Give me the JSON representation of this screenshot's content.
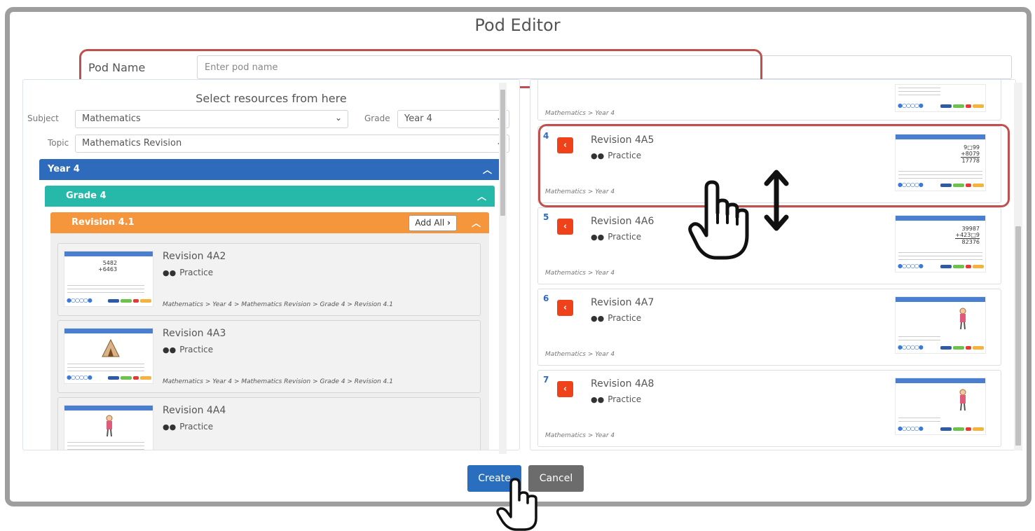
{
  "title": "Pod Editor",
  "pod_name": {
    "label": "Pod Name",
    "placeholder": "Enter pod name",
    "value": ""
  },
  "left": {
    "heading": "Select resources from here",
    "subject": {
      "label": "Subject",
      "value": "Mathematics"
    },
    "grade": {
      "label": "Grade",
      "value": "Year 4"
    },
    "topic": {
      "label": "Topic",
      "value": "Mathematics Revision"
    },
    "year_bar": "Year 4",
    "grade_bar": "Grade 4",
    "revision_bar": "Revision 4.1",
    "add_all": "Add All",
    "cards": [
      {
        "title": "Revision 4A2",
        "type": "Practice",
        "path": "Mathematics > Year 4 > Mathematics Revision > Grade 4 > Revision 4.1",
        "thumb_top": "5482",
        "thumb_bottom": "+6463"
      },
      {
        "title": "Revision 4A3",
        "type": "Practice",
        "path": "Mathematics > Year 4 > Mathematics Revision > Grade 4 > Revision 4.1"
      },
      {
        "title": "Revision 4A4",
        "type": "Practice",
        "path": ""
      }
    ]
  },
  "right": {
    "top_partial_path": "Mathematics > Year 4",
    "cards": [
      {
        "num": "4",
        "title": "Revision 4A5",
        "type": "Practice",
        "path": "Mathematics > Year 4",
        "thumb_a": "9□99",
        "thumb_b": "+8079",
        "thumb_c": "17778"
      },
      {
        "num": "5",
        "title": "Revision 4A6",
        "type": "Practice",
        "path": "Mathematics > Year 4",
        "thumb_a": "39987",
        "thumb_b": "+423□9",
        "thumb_c": "82376"
      },
      {
        "num": "6",
        "title": "Revision 4A7",
        "type": "Practice",
        "path": "Mathematics > Year 4"
      },
      {
        "num": "7",
        "title": "Revision 4A8",
        "type": "Practice",
        "path": "Mathematics > Year 4"
      }
    ]
  },
  "buttons": {
    "create": "Create",
    "cancel": "Cancel"
  },
  "colors": {
    "highlight": "#c0504d",
    "year_bar": "#2e6bbd",
    "grade_bar": "#26b9aa",
    "revision_bar": "#f5963c",
    "remove": "#f0421a",
    "create": "#2a6fbf",
    "cancel": "#6c6c6c"
  },
  "icons": {
    "practice": "glasses-icon",
    "remove": "chevron-left-icon",
    "collapse": "chevron-up-icon",
    "drag": "hand-pointer-icon",
    "reorder": "vertical-arrows-icon"
  }
}
